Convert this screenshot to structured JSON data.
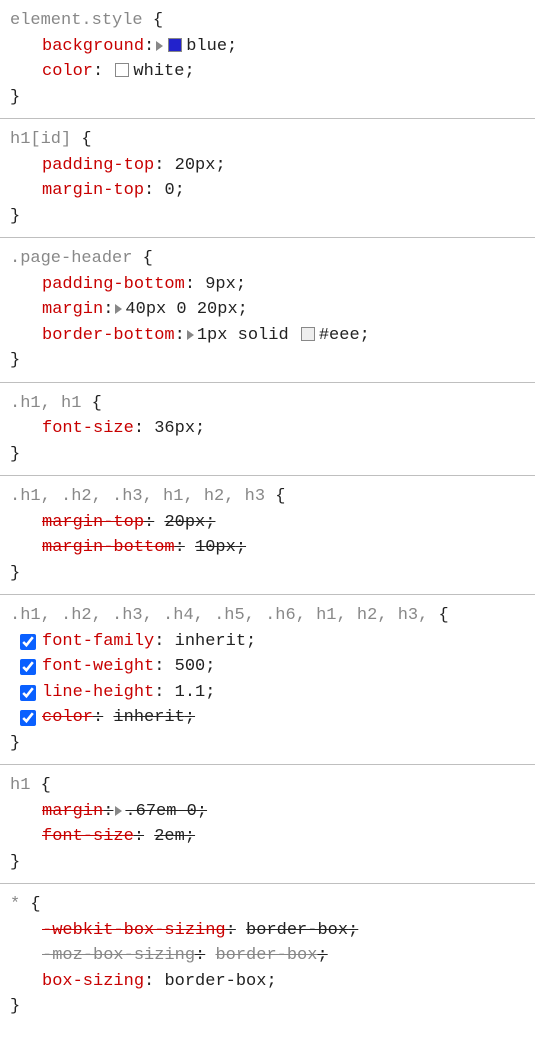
{
  "rules": [
    {
      "selector": [
        {
          "text": "element.style",
          "matched": false
        }
      ],
      "declarations": [
        {
          "property": "background",
          "value": "blue",
          "expandable": true,
          "swatch": "blue",
          "checkbox": null,
          "overridden": false,
          "struck": false
        },
        {
          "property": "color",
          "value": "white",
          "expandable": false,
          "swatch": "white",
          "checkbox": null,
          "overridden": false,
          "struck": false
        }
      ]
    },
    {
      "selector": [
        {
          "text": "h1[id]",
          "matched": true
        }
      ],
      "declarations": [
        {
          "property": "padding-top",
          "value": "20px",
          "expandable": false,
          "swatch": null,
          "checkbox": null,
          "overridden": false,
          "struck": false
        },
        {
          "property": "margin-top",
          "value": "0",
          "expandable": false,
          "swatch": null,
          "checkbox": null,
          "overridden": false,
          "struck": false
        }
      ]
    },
    {
      "selector": [
        {
          "text": ".page-header",
          "matched": true
        }
      ],
      "declarations": [
        {
          "property": "padding-bottom",
          "value": "9px",
          "expandable": false,
          "swatch": null,
          "checkbox": null,
          "overridden": false,
          "struck": false
        },
        {
          "property": "margin",
          "value": "40px 0 20px",
          "expandable": true,
          "swatch": null,
          "checkbox": null,
          "overridden": false,
          "struck": false
        },
        {
          "property": "border-bottom",
          "value": "1px solid ",
          "value2": "#eee",
          "expandable": true,
          "swatch": "eee",
          "swatchBeforeValue2": true,
          "checkbox": null,
          "overridden": false,
          "struck": false
        }
      ]
    },
    {
      "selector": [
        {
          "text": ".h1",
          "matched": false
        },
        {
          "text": ", ",
          "sep": true
        },
        {
          "text": "h1",
          "matched": true
        }
      ],
      "declarations": [
        {
          "property": "font-size",
          "value": "36px",
          "expandable": false,
          "swatch": null,
          "checkbox": null,
          "overridden": false,
          "struck": false
        }
      ]
    },
    {
      "selector": [
        {
          "text": ".h1",
          "matched": false
        },
        {
          "text": ", ",
          "sep": true
        },
        {
          "text": ".h2",
          "matched": false
        },
        {
          "text": ", ",
          "sep": true
        },
        {
          "text": ".h3",
          "matched": false
        },
        {
          "text": ", ",
          "sep": true
        },
        {
          "text": "h1",
          "matched": true
        },
        {
          "text": ", ",
          "sep": true
        },
        {
          "text": "h2",
          "matched": false
        },
        {
          "text": ", ",
          "sep": true
        },
        {
          "text": "h3",
          "matched": false
        }
      ],
      "declarations": [
        {
          "property": "margin-top",
          "value": "20px",
          "expandable": false,
          "swatch": null,
          "checkbox": null,
          "overridden": false,
          "struck": true
        },
        {
          "property": "margin-bottom",
          "value": "10px",
          "expandable": false,
          "swatch": null,
          "checkbox": null,
          "overridden": false,
          "struck": true
        }
      ]
    },
    {
      "selector": [
        {
          "text": ".h1",
          "matched": false
        },
        {
          "text": ", ",
          "sep": true
        },
        {
          "text": ".h2",
          "matched": false
        },
        {
          "text": ", ",
          "sep": true
        },
        {
          "text": ".h3",
          "matched": false
        },
        {
          "text": ", ",
          "sep": true
        },
        {
          "text": ".h4",
          "matched": false
        },
        {
          "text": ", ",
          "sep": true
        },
        {
          "text": ".h5",
          "matched": false
        },
        {
          "text": ", ",
          "sep": true
        },
        {
          "text": ".h6",
          "matched": false
        },
        {
          "text": ", ",
          "sep": true
        },
        {
          "text": "h1",
          "matched": true
        },
        {
          "text": ", ",
          "sep": true
        },
        {
          "text": "h2",
          "matched": false
        },
        {
          "text": ", ",
          "sep": true
        },
        {
          "text": "h3",
          "matched": false
        },
        {
          "text": ",",
          "sep": true
        }
      ],
      "declarations": [
        {
          "property": "font-family",
          "value": "inherit",
          "expandable": false,
          "swatch": null,
          "checkbox": true,
          "overridden": false,
          "struck": false
        },
        {
          "property": "font-weight",
          "value": "500",
          "expandable": false,
          "swatch": null,
          "checkbox": true,
          "overridden": false,
          "struck": false
        },
        {
          "property": "line-height",
          "value": "1.1",
          "expandable": false,
          "swatch": null,
          "checkbox": true,
          "overridden": false,
          "struck": false
        },
        {
          "property": "color",
          "value": "inherit",
          "expandable": false,
          "swatch": null,
          "checkbox": true,
          "overridden": false,
          "struck": true
        }
      ]
    },
    {
      "selector": [
        {
          "text": "h1",
          "matched": true
        }
      ],
      "declarations": [
        {
          "property": "margin",
          "value": ".67em 0",
          "expandable": true,
          "swatch": null,
          "checkbox": null,
          "overridden": false,
          "struck": true
        },
        {
          "property": "font-size",
          "value": "2em",
          "expandable": false,
          "swatch": null,
          "checkbox": null,
          "overridden": false,
          "struck": true
        }
      ]
    },
    {
      "selector": [
        {
          "text": "*",
          "matched": true
        }
      ],
      "declarations": [
        {
          "property": "-webkit-box-sizing",
          "value": "border-box",
          "expandable": false,
          "swatch": null,
          "checkbox": null,
          "overridden": false,
          "struck": true
        },
        {
          "property": "-moz-box-sizing",
          "value": "border-box",
          "expandable": false,
          "swatch": null,
          "checkbox": null,
          "overridden": true,
          "struck": true
        },
        {
          "property": "box-sizing",
          "value": "border-box",
          "expandable": false,
          "swatch": null,
          "checkbox": null,
          "overridden": false,
          "struck": false
        }
      ],
      "last": true
    }
  ]
}
